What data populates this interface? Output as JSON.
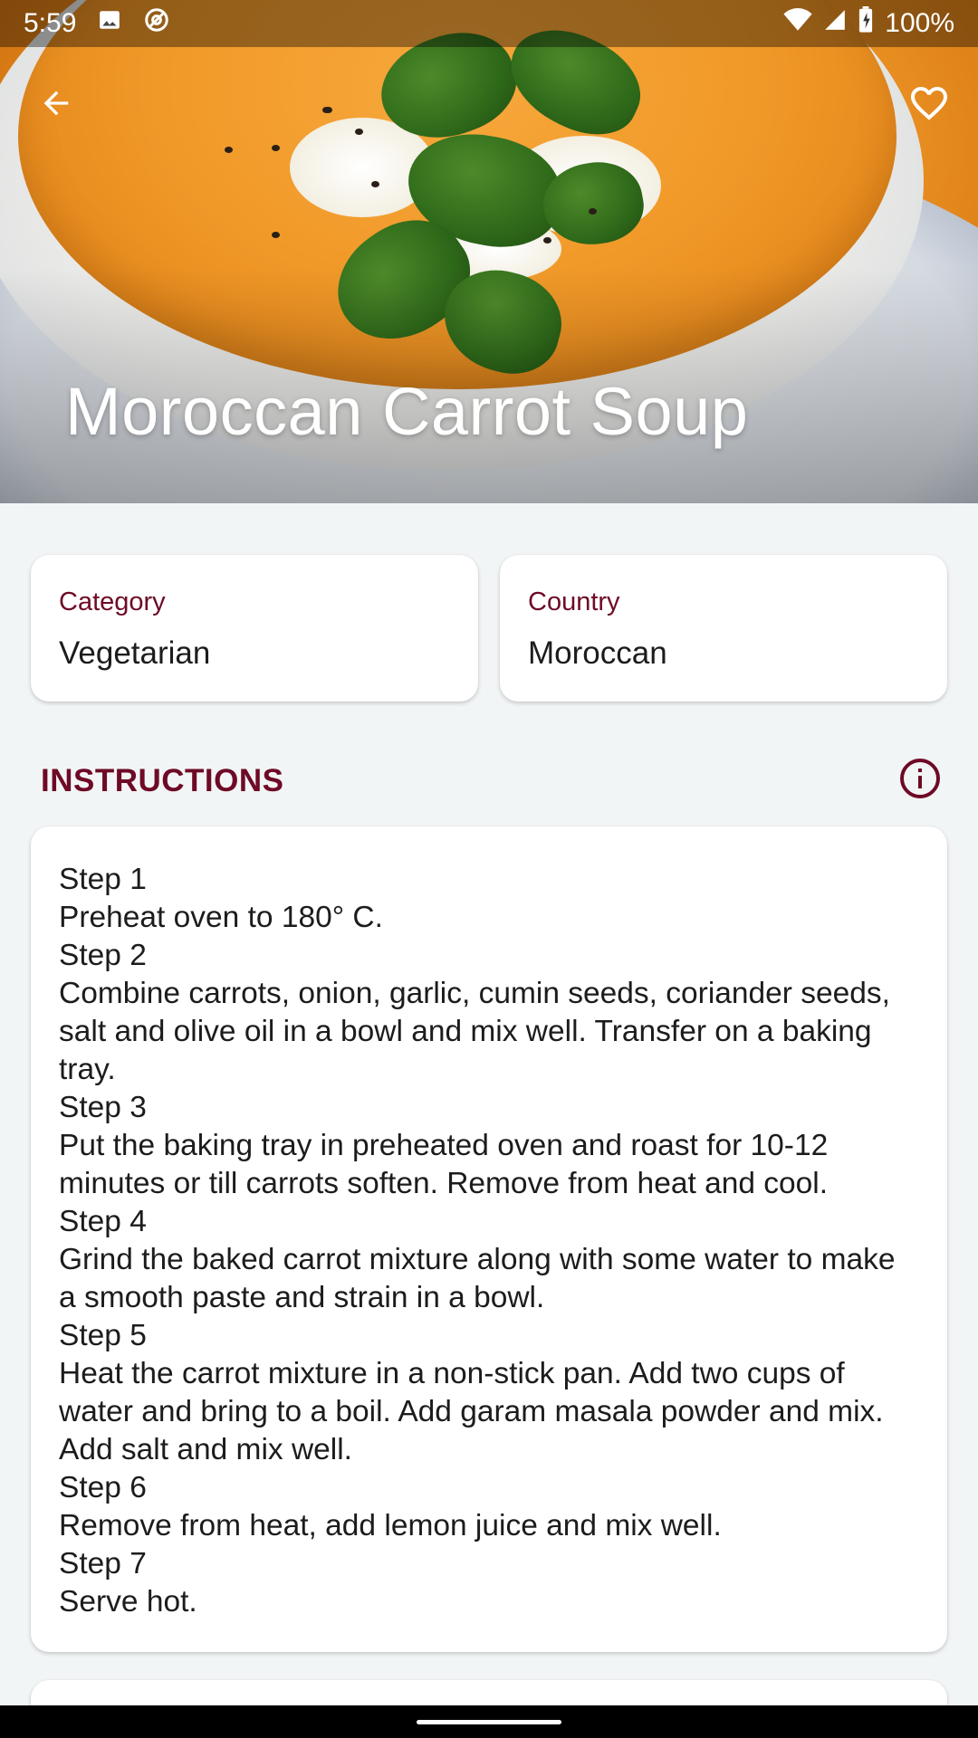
{
  "status_bar": {
    "time": "5:59",
    "battery": "100%",
    "icons": [
      "image-icon",
      "at-sign-icon",
      "wifi-icon",
      "signal-icon",
      "battery-icon"
    ]
  },
  "toolbar": {
    "back_icon": "arrow-left-icon",
    "favorite_icon": "heart-outline-icon"
  },
  "recipe": {
    "title": "Moroccan Carrot Soup",
    "hero_image": "carrot soup in white bowl garnished with cilantro and cream"
  },
  "info_cards": {
    "category": {
      "label": "Category",
      "value": "Vegetarian"
    },
    "country": {
      "label": "Country",
      "value": "Moroccan"
    }
  },
  "instructions": {
    "heading": "INSTRUCTIONS",
    "info_icon": "info-circle-icon",
    "text": "Step 1\nPreheat oven to 180° C.\nStep 2\nCombine carrots, onion, garlic, cumin seeds, coriander seeds, salt and olive oil in a bowl and mix well. Transfer on a baking tray.\nStep 3\nPut the baking tray in preheated oven and roast for 10-12 minutes or till carrots soften. Remove from heat and cool.\nStep 4\nGrind the baked carrot mixture along with some water to make a smooth paste and strain in a bowl.\nStep 5\nHeat the carrot mixture in a non-stick pan. Add two cups of water and bring to a boil. Add garam masala powder and mix. Add salt and mix well.\nStep 6\nRemove from heat, add lemon juice and mix well.\nStep 7\nServe hot."
  },
  "colors": {
    "accent": "#6e0a26",
    "background": "#f2f5f6",
    "card": "#ffffff"
  }
}
